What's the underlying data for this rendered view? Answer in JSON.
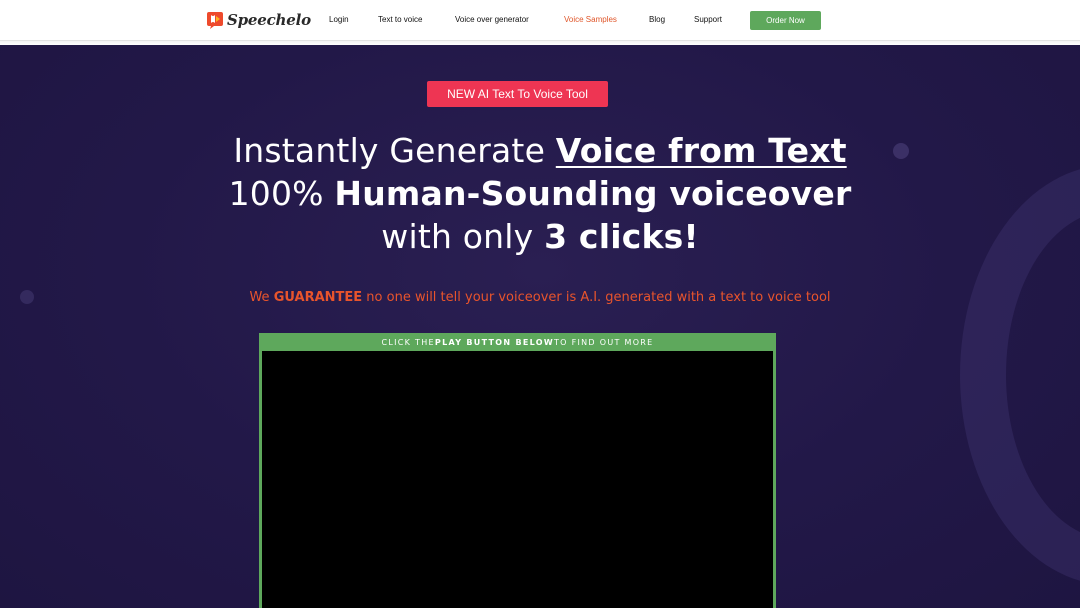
{
  "header": {
    "logo_text": "Speechelo",
    "nav": [
      {
        "label": "Login"
      },
      {
        "label": "Text to voice"
      },
      {
        "label": "Voice over generator"
      },
      {
        "label": "Voice Samples",
        "active": true
      },
      {
        "label": "Blog"
      },
      {
        "label": "Support"
      }
    ],
    "order_button": "Order Now"
  },
  "hero": {
    "badge": "NEW AI Text To Voice Tool",
    "line1_plain": "Instantly Generate ",
    "line1_underlined": "Voice from Text",
    "line2_plain": "100% ",
    "line2_bold": "Human-Sounding voiceover",
    "line3_plain": "with only ",
    "line3_bold": "3 clicks!",
    "guarantee_pre": "We ",
    "guarantee_bold": "GUARANTEE",
    "guarantee_post": " no one will tell your voiceover is A.I. generated with a text to voice tool"
  },
  "video": {
    "caption_pre": "CLICK THE ",
    "caption_bold": "PLAY BUTTON BELOW",
    "caption_post": " TO FIND OUT MORE"
  },
  "colors": {
    "background": "#221848",
    "accent_orange": "#e8542c",
    "badge_red": "#ee3553",
    "green": "#5ea85c"
  },
  "icons": {
    "logo": "speechelo-logo-icon"
  }
}
